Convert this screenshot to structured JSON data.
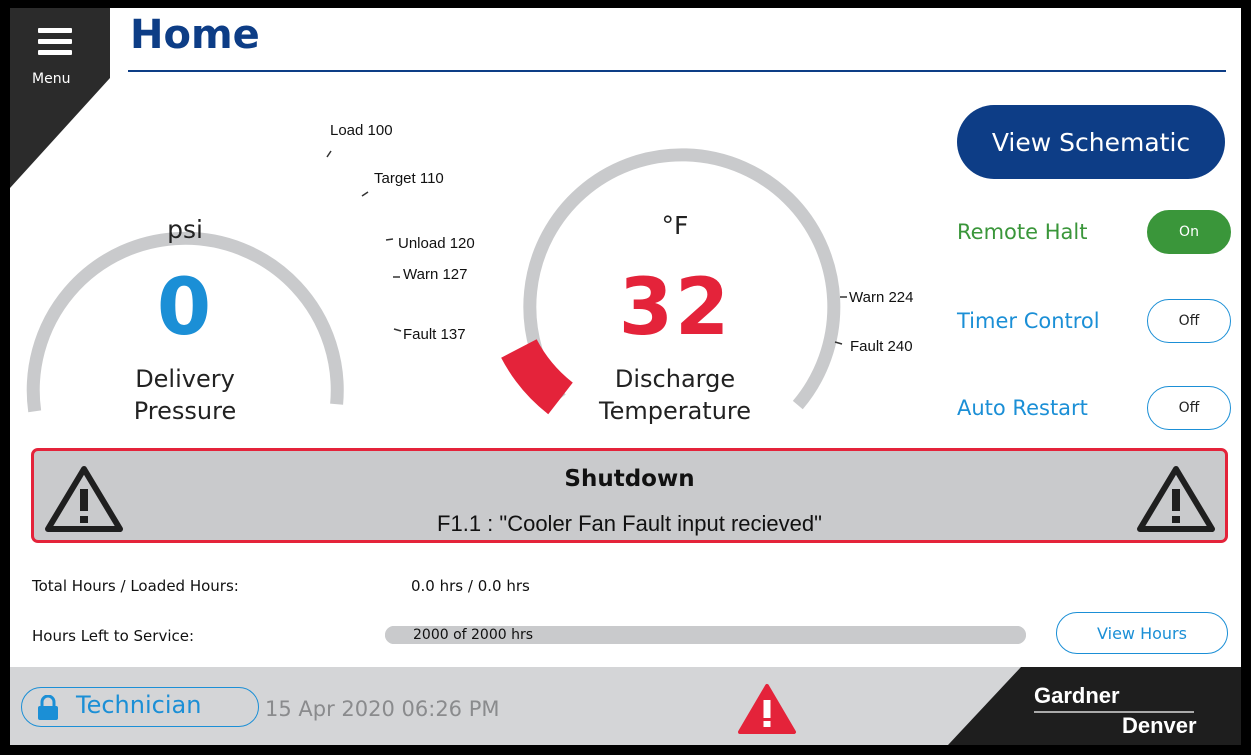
{
  "menu": {
    "label": "Menu"
  },
  "page": {
    "title": "Home"
  },
  "gauges": {
    "pressure": {
      "unit": "psi",
      "value": "0",
      "name_line1": "Delivery",
      "name_line2": "Pressure",
      "value_color": "#1b8fd6",
      "thresholds": [
        "Load 100",
        "Target 110",
        "Unload 120",
        "Warn 127",
        "Fault 137"
      ]
    },
    "temperature": {
      "unit": "°F",
      "value": "32",
      "name_line1": "Discharge",
      "name_line2": "Temperature",
      "value_color": "#e4233a",
      "thresholds": [
        "Warn 224",
        "Fault 240"
      ]
    }
  },
  "controls": {
    "view_schematic": "View Schematic",
    "remote_halt": {
      "label": "Remote Halt",
      "state": "On",
      "color": "#3a963a"
    },
    "timer_control": {
      "label": "Timer Control",
      "state": "Off",
      "color": "#1b8fd6"
    },
    "auto_restart": {
      "label": "Auto Restart",
      "state": "Off",
      "color": "#1b8fd6"
    }
  },
  "alarm": {
    "title": "Shutdown",
    "message": "F1.1 : \"Cooler Fan Fault input recieved\"",
    "icon": "warning-triangle-icon",
    "border_color": "#e4233a"
  },
  "hours": {
    "total_label": "Total Hours / Loaded Hours:",
    "total_value": "0.0 hrs / 0.0 hrs",
    "service_label": "Hours Left to Service:",
    "service_value": "2000 of 2000 hrs",
    "service_fraction": 1.0,
    "view_hours": "View Hours"
  },
  "footer": {
    "user_role": "Technician",
    "datetime": "15 Apr 2020  06:26 PM",
    "brand_line1": "Gardner",
    "brand_line2": "Denver",
    "alarm_icon": "warning-triangle-icon"
  }
}
